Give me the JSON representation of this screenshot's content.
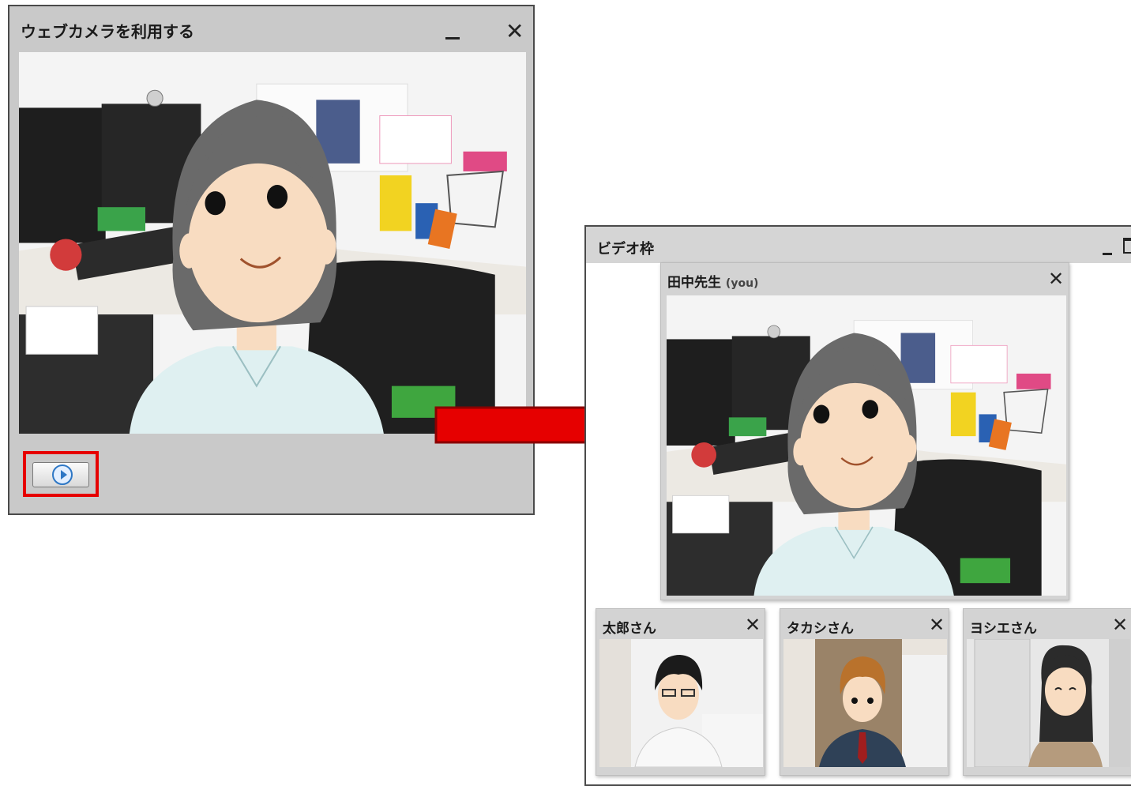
{
  "webcam_window": {
    "title": "ウェブカメラを利用する",
    "minimize_icon": "minimize-icon",
    "close_icon": "close-icon",
    "close_glyph": "✕",
    "start_button_icon": "play-circle-icon",
    "highlight_color": "#e60000"
  },
  "arrow": {
    "color": "#e60000"
  },
  "video_window": {
    "title": "ビデオ枠",
    "main_panel": {
      "name": "田中先生",
      "suffix": "(you)",
      "close_glyph": "✕"
    },
    "participants": [
      {
        "name": "太郎さん",
        "close_glyph": "✕"
      },
      {
        "name": "タカシさん",
        "close_glyph": "✕"
      },
      {
        "name": "ヨシエさん",
        "close_glyph": "✕"
      }
    ]
  }
}
